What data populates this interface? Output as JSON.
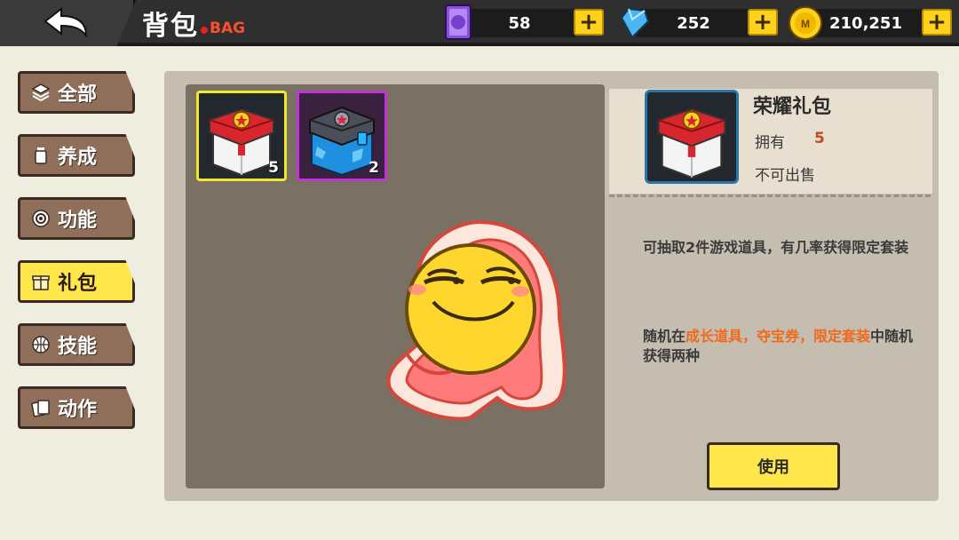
{
  "header": {
    "title": "背包",
    "subtitle": "BAG",
    "resources": [
      {
        "icon": "ticket-card-icon",
        "value": "58"
      },
      {
        "icon": "diamond-icon",
        "value": "252"
      },
      {
        "icon": "gold-coin-icon",
        "value": "210,251"
      }
    ],
    "plus_label": "+"
  },
  "sidebar": {
    "items": [
      {
        "label": "全部",
        "icon": "layers-icon"
      },
      {
        "label": "养成",
        "icon": "bottle-icon"
      },
      {
        "label": "功能",
        "icon": "target-icon"
      },
      {
        "label": "礼包",
        "icon": "gift-icon",
        "active": true
      },
      {
        "label": "技能",
        "icon": "basketball-icon"
      },
      {
        "label": "动作",
        "icon": "cards-icon"
      }
    ]
  },
  "inventory": {
    "slots": [
      {
        "name": "red-gift-box",
        "count": "5",
        "selected": true
      },
      {
        "name": "blue-mystery-box",
        "count": "2",
        "selected": false
      }
    ]
  },
  "detail": {
    "name": "荣耀礼包",
    "own_label": "拥有",
    "own_value": "5",
    "sell_text": "不可出售",
    "desc1": "可抽取2件游戏道具，有几率获得限定套装",
    "desc2_prefix": "随机在",
    "desc2_highlight1": "成长道具，夺宝券，限定套装",
    "desc2_suffix": "中随机获得两种",
    "use_label": "使用"
  },
  "colors": {
    "accent_yellow": "#ffe64a",
    "highlight_orange": "#f06a1c",
    "topbar": "#2f2f2f"
  }
}
